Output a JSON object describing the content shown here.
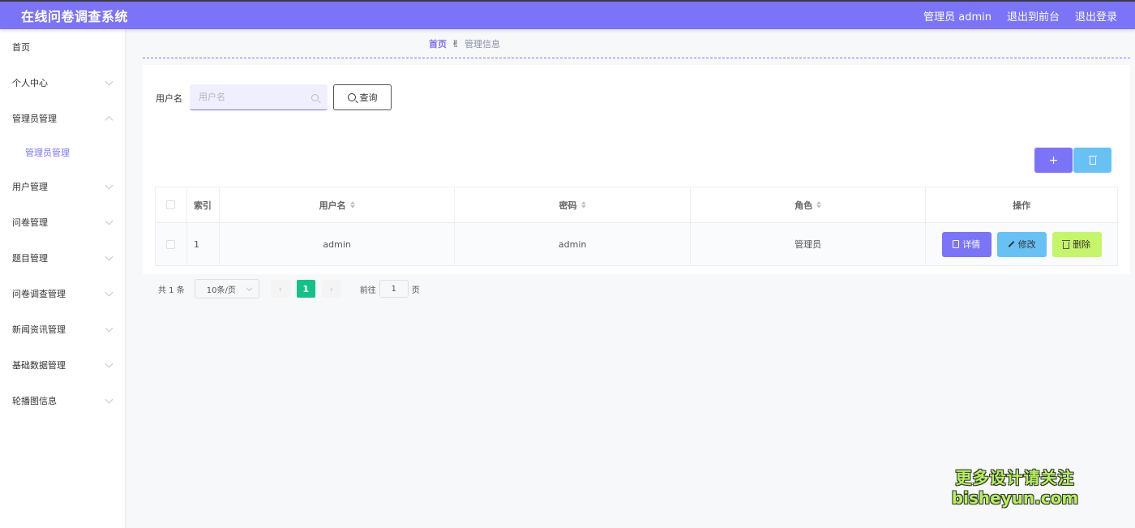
{
  "app": {
    "title": "在线问卷调查系统"
  },
  "header": {
    "user_label": "管理员 admin",
    "to_front": "退出到前台",
    "logout": "退出登录"
  },
  "sidebar": {
    "items": [
      {
        "label": "首页"
      },
      {
        "label": "个人中心"
      },
      {
        "label": "管理员管理",
        "expanded": true,
        "children": [
          {
            "label": "管理员管理",
            "active": true
          }
        ]
      },
      {
        "label": "用户管理"
      },
      {
        "label": "问卷管理"
      },
      {
        "label": "题目管理"
      },
      {
        "label": "问卷调查管理"
      },
      {
        "label": "新闻资讯管理"
      },
      {
        "label": "基础数据管理"
      },
      {
        "label": "轮播图信息"
      }
    ]
  },
  "breadcrumb": {
    "home": "首页",
    "separator": "✌",
    "current": "管理信息"
  },
  "search": {
    "label": "用户名",
    "placeholder": "用户名",
    "value": "",
    "button": "查询"
  },
  "toolbar": {
    "add_label": "+"
  },
  "table": {
    "columns": [
      "索引",
      "用户名",
      "密码",
      "角色",
      "操作"
    ],
    "rows": [
      {
        "index": "1",
        "username": "admin",
        "password": "admin",
        "role": "管理员"
      }
    ],
    "actions": {
      "detail": "详情",
      "edit": "修改",
      "delete": "删除"
    }
  },
  "pagination": {
    "total_text": "共 1 条",
    "page_size": "10条/页",
    "current_page": "1",
    "goto_label": "前往",
    "goto_value": "1",
    "page_unit": "页",
    "prev": "‹",
    "next": "›"
  },
  "watermark": {
    "line1": "更多设计请关注",
    "line2": "bisheyun.com"
  },
  "colors": {
    "primary": "#7b73f8",
    "info": "#67c1f5",
    "success": "#16c08b",
    "lime": "#c7f56a"
  }
}
